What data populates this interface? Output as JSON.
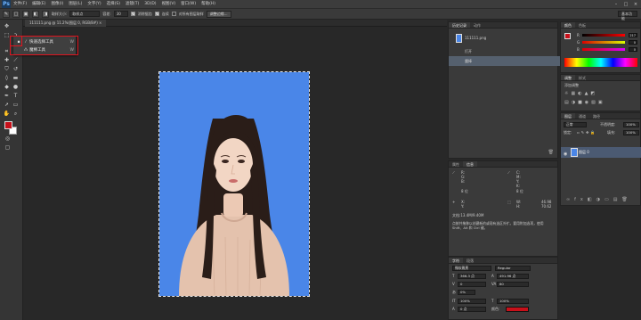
{
  "app": {
    "logo": "Ps",
    "brand_color": "#31a8ff"
  },
  "menu": {
    "items": [
      "文件(F)",
      "编辑(E)",
      "图像(I)",
      "图层(L)",
      "文字(Y)",
      "选择(S)",
      "滤镜(T)",
      "3D(D)",
      "视图(V)",
      "窗口(W)",
      "帮助(H)"
    ],
    "window_controls": [
      "–",
      "□",
      "×"
    ]
  },
  "options_bar": {
    "brush_size_label": "新选区",
    "tolerance_select": "取样大小:",
    "sample_value": "取样点",
    "tolerance_label": "容差:",
    "tolerance_value": "30",
    "antialias_label": "消除锯齿",
    "contiguous_label": "连续",
    "sample_all_label": "对所有图层取样",
    "refine_button": "调整边缘...",
    "workspace": "基本功能"
  },
  "document": {
    "tab_title": "111111.png @ 11.2%(图层 0, RGB/8#) ×",
    "background_color": "#4a86e8"
  },
  "flyout": {
    "items": [
      {
        "label": "快速选择工具",
        "key": "W",
        "icon": "quick-selection-icon",
        "active": true
      },
      {
        "label": "魔棒工具",
        "key": "W",
        "icon": "magic-wand-icon",
        "active": false
      }
    ],
    "highlight_color": "#e0141e"
  },
  "colors": {
    "foreground": "#c8101a",
    "background": "#ffffff"
  },
  "history_panel": {
    "tabs": [
      "历史记录",
      "动作"
    ],
    "snapshot": "111111.png",
    "items": [
      "打开",
      "魔棒"
    ]
  },
  "color_panel": {
    "tabs": [
      "颜色",
      "色板"
    ],
    "channels": [
      {
        "name": "R",
        "value": "217"
      },
      {
        "name": "G",
        "value": "0"
      },
      {
        "name": "B",
        "value": "0"
      }
    ]
  },
  "adjustments_panel": {
    "tabs": [
      "调整",
      "样式"
    ],
    "label": "添加调整"
  },
  "layers_panel": {
    "tabs": [
      "图层",
      "通道",
      "路径"
    ],
    "blend_mode": "正常",
    "opacity_label": "不透明度:",
    "opacity_value": "100%",
    "lock_label": "锁定:",
    "fill_label": "填充:",
    "fill_value": "100%",
    "layer_name": "图层 0"
  },
  "info_panel": {
    "tabs": [
      "属性",
      "信息"
    ],
    "rgb_labels": [
      "R:",
      "G:",
      "B:"
    ],
    "cmyk_labels": [
      "C:",
      "M:",
      "Y:",
      "K:"
    ],
    "bit_left": "8 位",
    "bit_right": "8 位",
    "x_label": "X:",
    "y_label": "Y:",
    "w_label": "W:",
    "h_label": "H:",
    "x_value": "46.98",
    "y_value": "70.62",
    "doc_size": "文档:13.4M/9.40M",
    "hint": "点按并拖移以创建新的或现有选区外扩。要用附加选项，使用 Shift、Alt 和 Ctrl 键。"
  },
  "character_panel": {
    "tabs": [
      "字符",
      "段落"
    ],
    "font_family": "微软雅黑",
    "font_style": "Regular",
    "font_size": "366.3 点",
    "leading": "491.96 点",
    "kerning": "0",
    "tracking": "80",
    "scale_v": "100%",
    "scale_h": "100%",
    "baseline": "0 点",
    "color_label": "颜色:",
    "percent": "0%",
    "color_value": "#c8101a"
  }
}
